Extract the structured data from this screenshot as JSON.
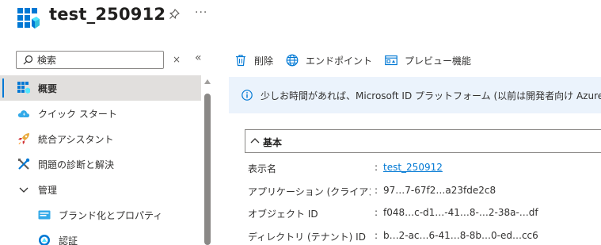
{
  "header": {
    "title": "test_250912",
    "pin_icon": "pin-icon",
    "more_label": "···"
  },
  "search": {
    "placeholder": "検索",
    "clear_label": "×",
    "collapse_label": "«"
  },
  "nav": {
    "items": [
      {
        "label": "概要",
        "icon": "overview-grid-icon",
        "selected": true
      },
      {
        "label": "クイック スタート",
        "icon": "cloud-icon"
      },
      {
        "label": "統合アシスタント",
        "icon": "rocket-icon"
      },
      {
        "label": "問題の診断と解決",
        "icon": "tools-icon"
      },
      {
        "label": "管理",
        "icon": "chevron-down-icon",
        "expanded": true
      },
      {
        "label": "ブランド化とプロパティ",
        "icon": "branding-icon"
      },
      {
        "label": "認証",
        "icon": "auth-icon"
      }
    ]
  },
  "toolbar": {
    "delete_label": "削除",
    "endpoints_label": "エンドポイント",
    "preview_label": "プレビュー機能"
  },
  "info": {
    "text": "少しお時間があれば、Microsoft ID プラットフォーム (以前は開発者向け Azure AD) に関"
  },
  "essentials": {
    "title": "基本",
    "rows": [
      {
        "label": "表示名",
        "colon": ":",
        "value": "test_250912"
      },
      {
        "label": "アプリケーション (クライアント…",
        "colon": ":",
        "value": "97…7-67f2…a23fde2c8"
      },
      {
        "label": "オブジェクト ID",
        "colon": ":",
        "value": "f048…c-d1…-41…8-…2-38a-…df"
      },
      {
        "label": "ディレクトリ (テナント) ID",
        "colon": ":",
        "value": "b…2-ac…6-41…8-8b…0-ed…cc6"
      }
    ]
  },
  "colors": {
    "accent": "#0078d4",
    "selected_bg": "#e1dfdd",
    "info_bg": "#ebf3fc"
  }
}
